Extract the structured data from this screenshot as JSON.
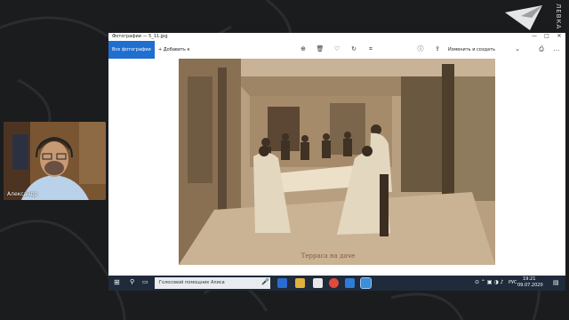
{
  "brand": {
    "logo_text": "ЛЕВКА"
  },
  "webcam": {
    "participant_name": "Александр"
  },
  "photo_app": {
    "window_title": "Фотографии — 5_11.jpg",
    "window_controls": [
      "—",
      "□",
      "✕"
    ],
    "all_photos_label": "Все фотографии",
    "add_to_label": "+ Добавить к",
    "edit_create_label": "Изменить и создать",
    "toolbar_icons": [
      "zoom-icon",
      "delete-icon",
      "heart-icon",
      "rotate-icon",
      "crop-icon",
      "info-icon",
      "share-icon",
      "print-icon",
      "more-icon"
    ],
    "photo_caption": "Терраса на даче"
  },
  "taskbar": {
    "search_placeholder": "Голосовой помощник Алиса",
    "language": "РУС",
    "time": "19:21",
    "date": "09.07.2020"
  },
  "colors": {
    "accent": "#1e6fd0",
    "taskbar": "#1f2a3a",
    "background": "#1b1c1e"
  }
}
